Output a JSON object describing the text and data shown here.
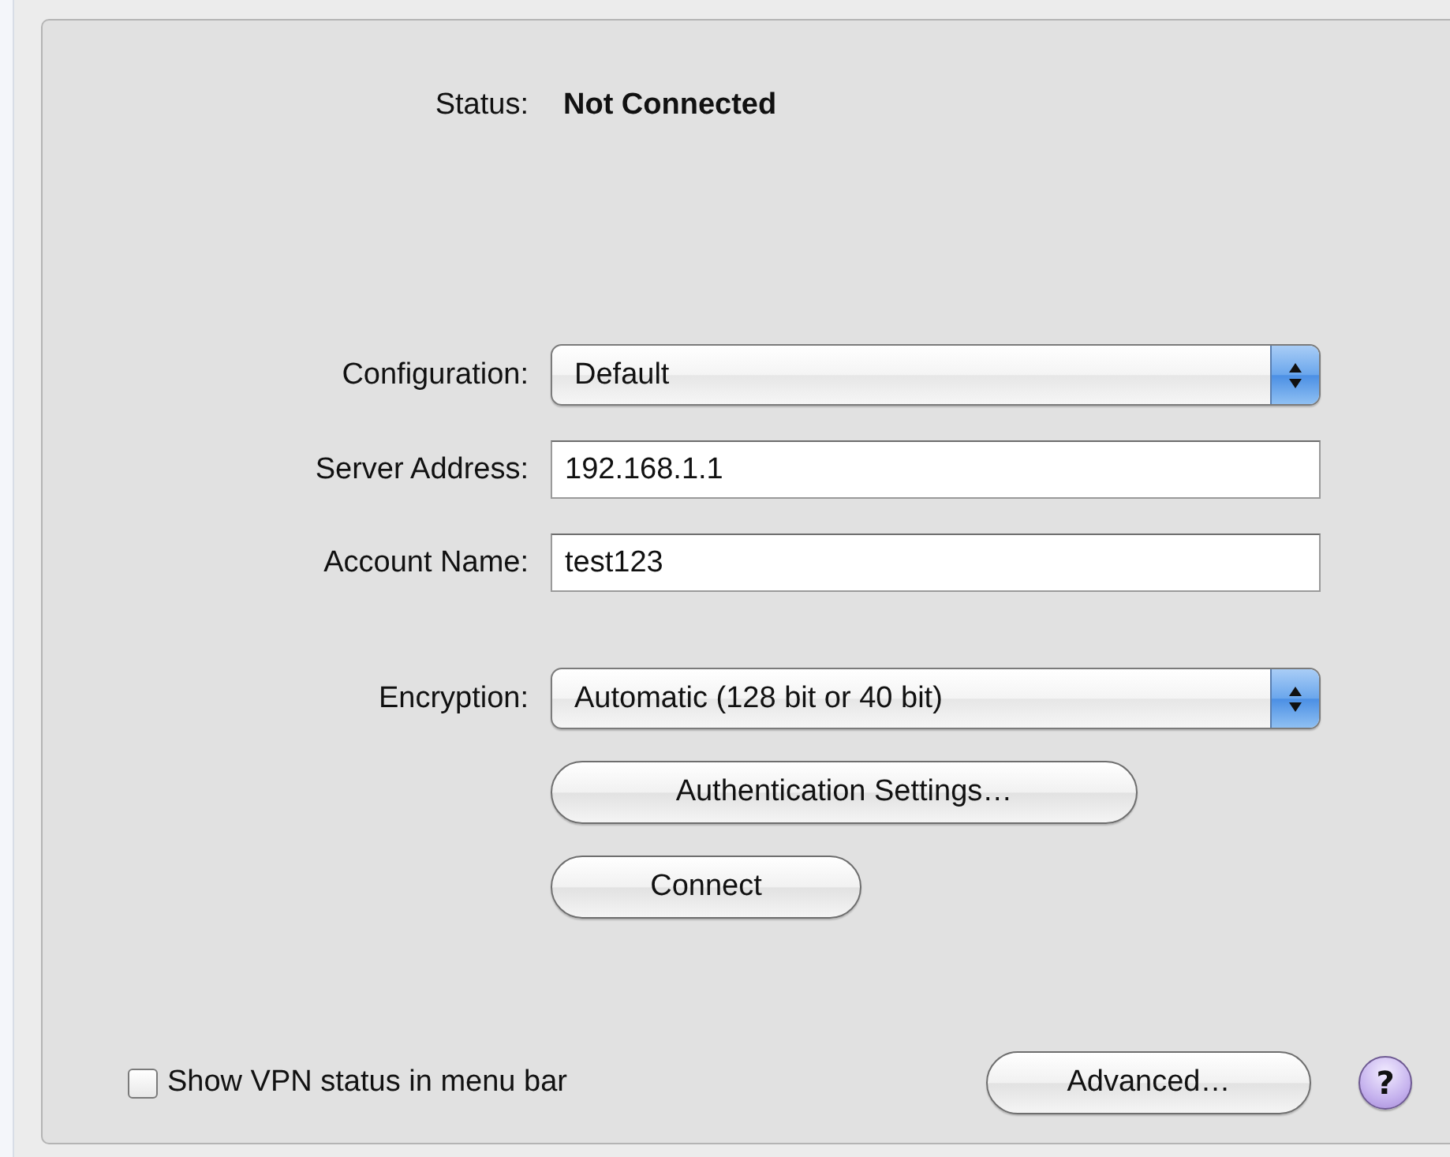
{
  "status": {
    "label": "Status:",
    "value": "Not Connected"
  },
  "form": [
    {
      "kind": "popup",
      "label": "Configuration:",
      "value": "Default"
    },
    {
      "kind": "text",
      "label": "Server Address:",
      "value": "192.168.1.1"
    },
    {
      "kind": "text",
      "label": "Account Name:",
      "value": "test123"
    },
    {
      "kind": "popup",
      "label": "Encryption:",
      "value": "Automatic (128 bit or 40 bit)"
    }
  ],
  "buttons": [
    {
      "label": "Authentication Settings…"
    },
    {
      "label": "Connect"
    }
  ],
  "show_vpn_status": {
    "label": "Show VPN status in menu bar",
    "checked": false
  },
  "advanced_button": "Advanced…",
  "help_button": "?"
}
